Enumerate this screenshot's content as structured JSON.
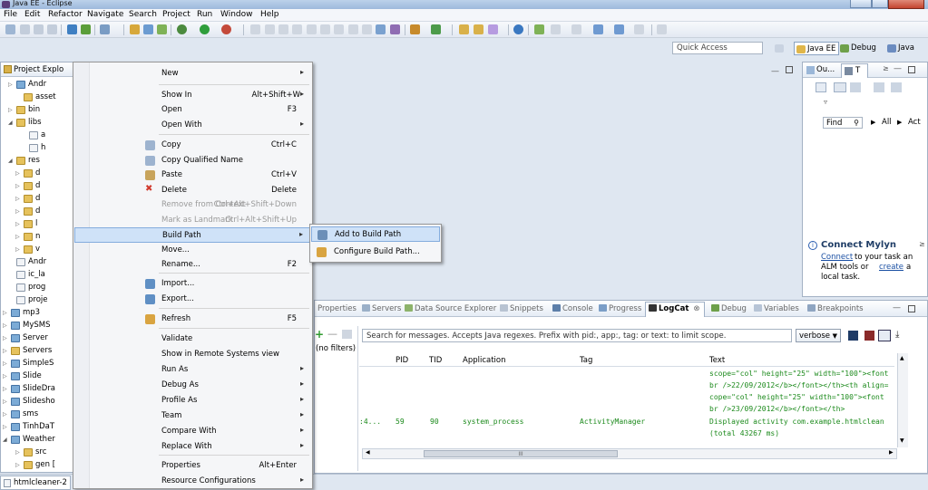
{
  "window": {
    "title": "Java EE - Eclipse"
  },
  "menubar": [
    "File",
    "Edit",
    "Refactor",
    "Navigate",
    "Search",
    "Project",
    "Run",
    "Window",
    "Help"
  ],
  "quick_access": {
    "placeholder": "Quick Access"
  },
  "perspectives": [
    {
      "label": "Java EE",
      "active": true
    },
    {
      "label": "Debug",
      "active": false
    },
    {
      "label": "Java",
      "active": false
    }
  ],
  "project_explorer": {
    "title": "Project Explo",
    "items": [
      "Andr",
      "asset",
      "bin",
      "libs",
      "a",
      "h",
      "res",
      "d",
      "d",
      "d",
      "d",
      "l",
      "n",
      "v",
      "Andr",
      "ic_la",
      "prog",
      "proje",
      "mp3",
      "MySMS",
      "Server",
      "Servers",
      "SimpleS",
      "Slide",
      "SlideDra",
      "Slidesho",
      "sms",
      "TinhDaT",
      "Weather",
      "src",
      "gen ["
    ]
  },
  "context_menu": {
    "items": [
      {
        "label": "New",
        "submenu": true
      },
      {
        "label": "Show In",
        "shortcut": "Alt+Shift+W",
        "submenu": true
      },
      {
        "label": "Open",
        "shortcut": "F3"
      },
      {
        "label": "Open With",
        "submenu": true
      },
      {
        "label": "Copy",
        "shortcut": "Ctrl+C",
        "icon": "copy-icon"
      },
      {
        "label": "Copy Qualified Name",
        "icon": "copy-qualified-icon"
      },
      {
        "label": "Paste",
        "shortcut": "Ctrl+V",
        "icon": "paste-icon"
      },
      {
        "label": "Delete",
        "shortcut": "Delete",
        "icon": "delete-icon"
      },
      {
        "label": "Remove from Context",
        "shortcut": "Ctrl+Alt+Shift+Down",
        "disabled": true
      },
      {
        "label": "Mark as Landmark",
        "shortcut": "Ctrl+Alt+Shift+Up",
        "disabled": true
      },
      {
        "label": "Build Path",
        "submenu": true,
        "highlighted": true
      },
      {
        "label": "Move..."
      },
      {
        "label": "Rename...",
        "shortcut": "F2"
      },
      {
        "label": "Import...",
        "icon": "import-icon"
      },
      {
        "label": "Export...",
        "icon": "export-icon"
      },
      {
        "label": "Refresh",
        "shortcut": "F5",
        "icon": "refresh-icon"
      },
      {
        "label": "Validate"
      },
      {
        "label": "Show in Remote Systems view"
      },
      {
        "label": "Run As",
        "submenu": true
      },
      {
        "label": "Debug As",
        "submenu": true
      },
      {
        "label": "Profile As",
        "submenu": true
      },
      {
        "label": "Team",
        "submenu": true
      },
      {
        "label": "Compare With",
        "submenu": true
      },
      {
        "label": "Replace With",
        "submenu": true
      },
      {
        "label": "Properties",
        "shortcut": "Alt+Enter"
      },
      {
        "label": "Resource Configurations",
        "submenu": true
      }
    ]
  },
  "submenu": {
    "items": [
      {
        "label": "Add to Build Path",
        "highlighted": true
      },
      {
        "label": "Configure Build Path..."
      }
    ]
  },
  "outline": {
    "tabs": [
      "Ou...",
      "T"
    ],
    "find_label": "Find",
    "all_label": "All",
    "act_label": "Act",
    "mylyn_title": "Connect Mylyn",
    "mylyn_link1": "Connect",
    "mylyn_text1": "to your task an",
    "mylyn_text2": "ALM tools or",
    "mylyn_link2": "create",
    "mylyn_text3": "a",
    "mylyn_text4": "local task."
  },
  "bottom_panel": {
    "tabs": [
      "Properties",
      "Servers",
      "Data Source Explorer",
      "Snippets",
      "Console",
      "Progress",
      "LogCat",
      "Debug",
      "Variables",
      "Breakpoints"
    ],
    "active_tab": "LogCat",
    "search_placeholder": "Search for messages. Accepts Java regexes. Prefix with pid:, app:, tag: or text: to limit scope.",
    "level": "verbose",
    "filters_label": "(no filters)",
    "columns": [
      "PID",
      "TID",
      "Application",
      "Tag",
      "Text"
    ],
    "rows": [
      {
        "text": "scope=\"col\" height=\"25\" width=\"100\"><font"
      },
      {
        "text": "br />22/09/2012</b></font></th><th align="
      },
      {
        "text": "cope=\"col\" height=\"25\" width=\"100\"><font"
      },
      {
        "text": "br />23/09/2012</b></font></th>"
      },
      {
        "time": ":4...",
        "pid": "59",
        "tid": "90",
        "application": "system_process",
        "tag": "ActivityManager",
        "text": "Displayed activity com.example.htmlclean"
      },
      {
        "text": "(total 43267 ms)"
      }
    ],
    "scroll_thumb": "III"
  },
  "status_tab": "htmlcleaner-2",
  "colors": {
    "menu_highlight": "#cfe2f8",
    "mylyn_link": "#1a4fa3",
    "logcat_green": "#1c8a1c",
    "logcat_blue": "#1f3fa8"
  }
}
